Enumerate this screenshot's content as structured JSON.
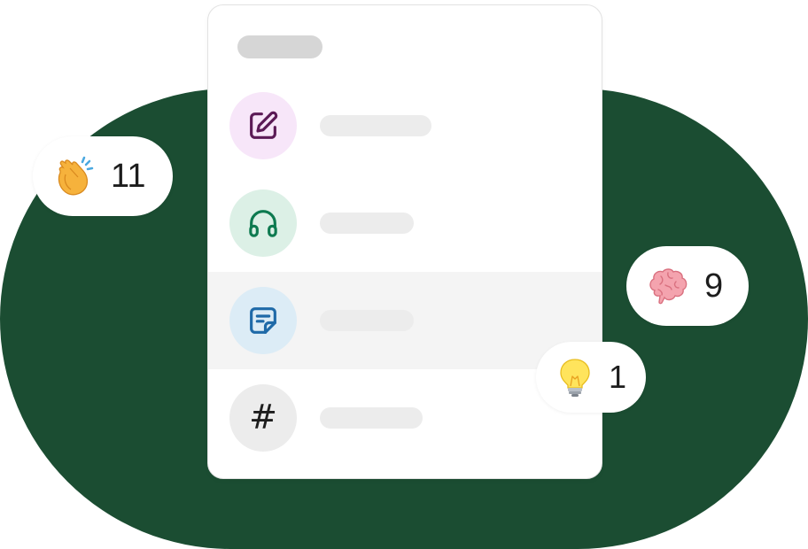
{
  "reactions": {
    "clap": {
      "emoji": "clapping-hands",
      "count": "11"
    },
    "brain": {
      "emoji": "brain",
      "count": "9"
    },
    "bulb": {
      "emoji": "light-bulb",
      "count": "1"
    }
  },
  "card": {
    "rows": [
      {
        "icon": "compose-icon",
        "icon_bg": "#f7e6f9",
        "icon_color": "#5b1a56"
      },
      {
        "icon": "headphones-icon",
        "icon_bg": "#dcf0e6",
        "icon_color": "#0e7a50"
      },
      {
        "icon": "canvas-note-icon",
        "icon_bg": "#dcecf6",
        "icon_color": "#1f6aa8"
      },
      {
        "icon": "hash-icon",
        "icon_bg": "#ececec",
        "icon_color": "#1d1d1d",
        "glyph": "#"
      }
    ]
  },
  "colors": {
    "background_shape": "#1b4d32",
    "highlight_row": "#f4f4f4",
    "placeholder_bar": "#ececec"
  }
}
